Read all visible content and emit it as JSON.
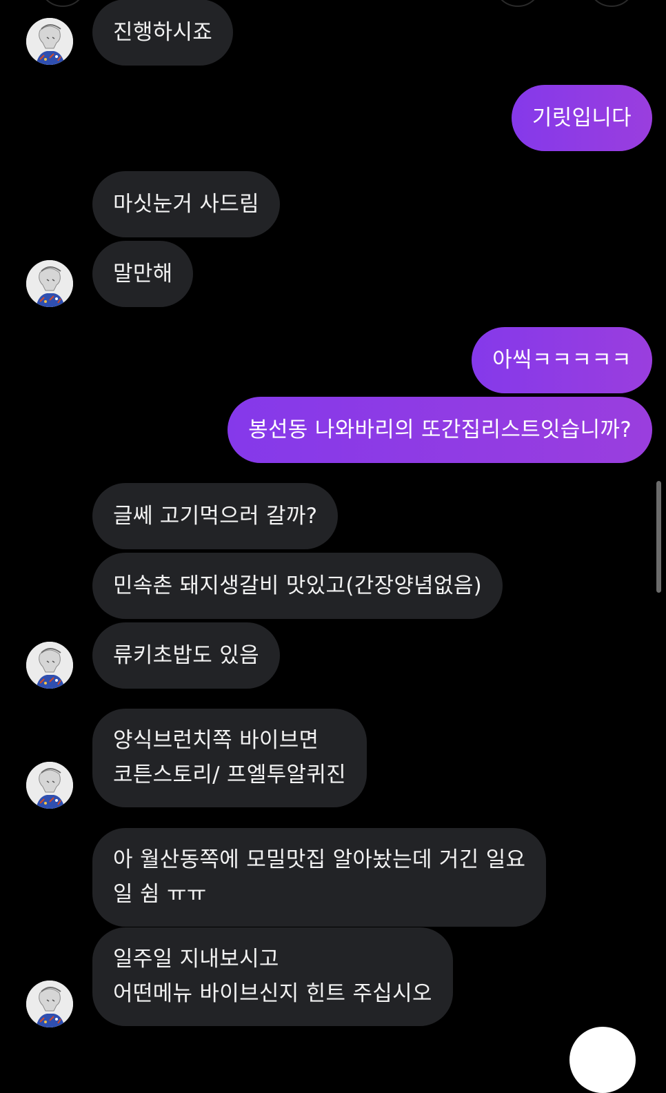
{
  "messages": [
    {
      "side": "in",
      "text": "진행하시죠"
    },
    {
      "side": "out",
      "text": "기릿입니다"
    },
    {
      "side": "in",
      "text": "마싯눈거 사드림"
    },
    {
      "side": "in",
      "text": "말만해"
    },
    {
      "side": "out",
      "text": "아씩ㅋㅋㅋㅋㅋ"
    },
    {
      "side": "out",
      "text": "봉선동 나와바리의 또간집리스트잇습니까?"
    },
    {
      "side": "in",
      "text": "글쎄 고기먹으러 갈까?"
    },
    {
      "side": "in",
      "text": "민속촌 돼지생갈비 맛있고(간장양념없음)"
    },
    {
      "side": "in",
      "text": "류키초밥도 있음"
    },
    {
      "side": "in",
      "lines": [
        "양식브런치쪽 바이브면",
        "코튼스토리/ 프엘투알퀴진"
      ]
    },
    {
      "side": "in",
      "lines": [
        "아 월산동쪽에 모밀맛집 알아놨는데 거긴 일요",
        "일 쉼 ㅠㅠ"
      ]
    },
    {
      "side": "in",
      "lines": [
        "일주일 지내보시고",
        "어떤메뉴 바이브신지 힌트 주십시오"
      ]
    }
  ],
  "colors": {
    "background": "#000000",
    "incoming_bubble": "#222326",
    "outgoing_bubble": "#8f3fe3",
    "text": "#f2f2f2"
  },
  "icons": {
    "avatar": "profile-avatar-sketch",
    "floating": "floating-action-button"
  }
}
